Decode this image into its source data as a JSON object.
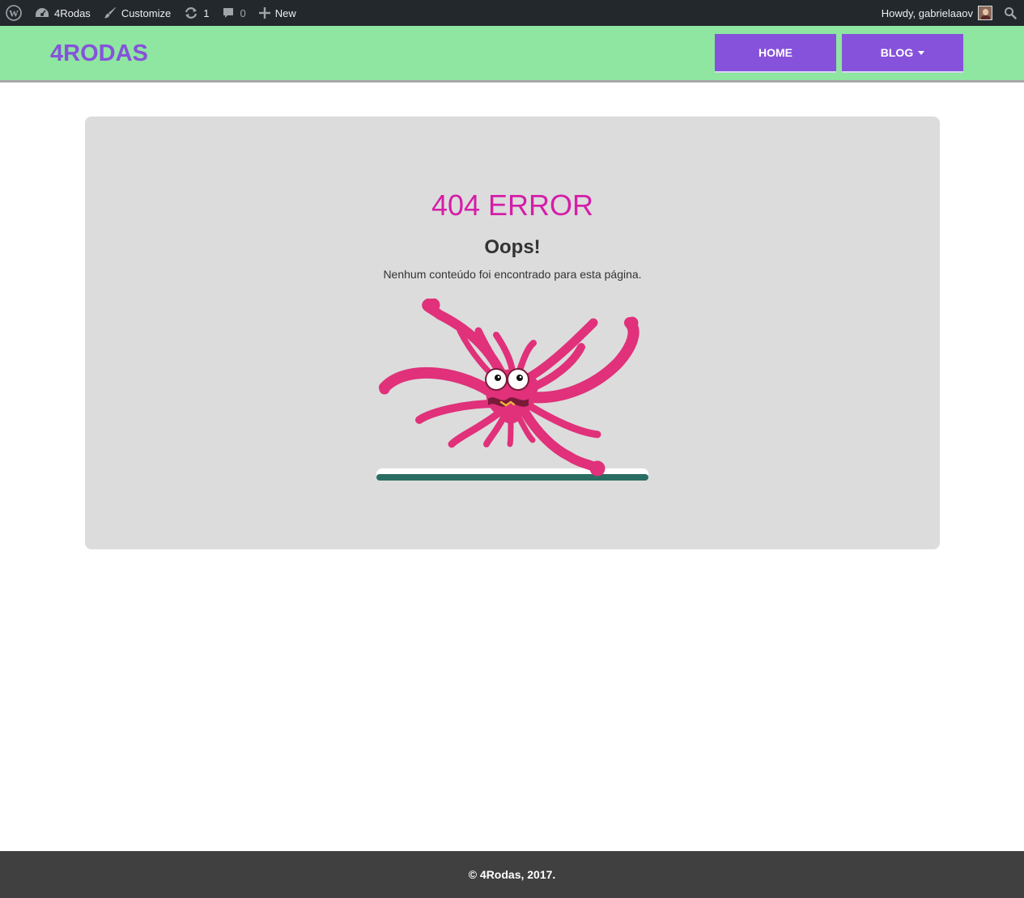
{
  "adminbar": {
    "site_name": "4Rodas",
    "customize_label": "Customize",
    "updates_count": "1",
    "comments_count": "0",
    "new_label": "New",
    "howdy_label": "Howdy, gabrielaaov"
  },
  "header": {
    "logo": "4RODAS",
    "nav": [
      {
        "label": "HOME"
      },
      {
        "label": "BLOG"
      }
    ]
  },
  "error": {
    "title": "404 ERROR",
    "subtitle": "Oops!",
    "message": "Nenhum conteúdo foi encontrado para esta página."
  },
  "footer": {
    "text": "© 4Rodas, 2017."
  },
  "colors": {
    "header_bg": "#8ee6a0",
    "accent": "#8652db",
    "error_title": "#d41ea8",
    "splat": "#e0317a"
  }
}
